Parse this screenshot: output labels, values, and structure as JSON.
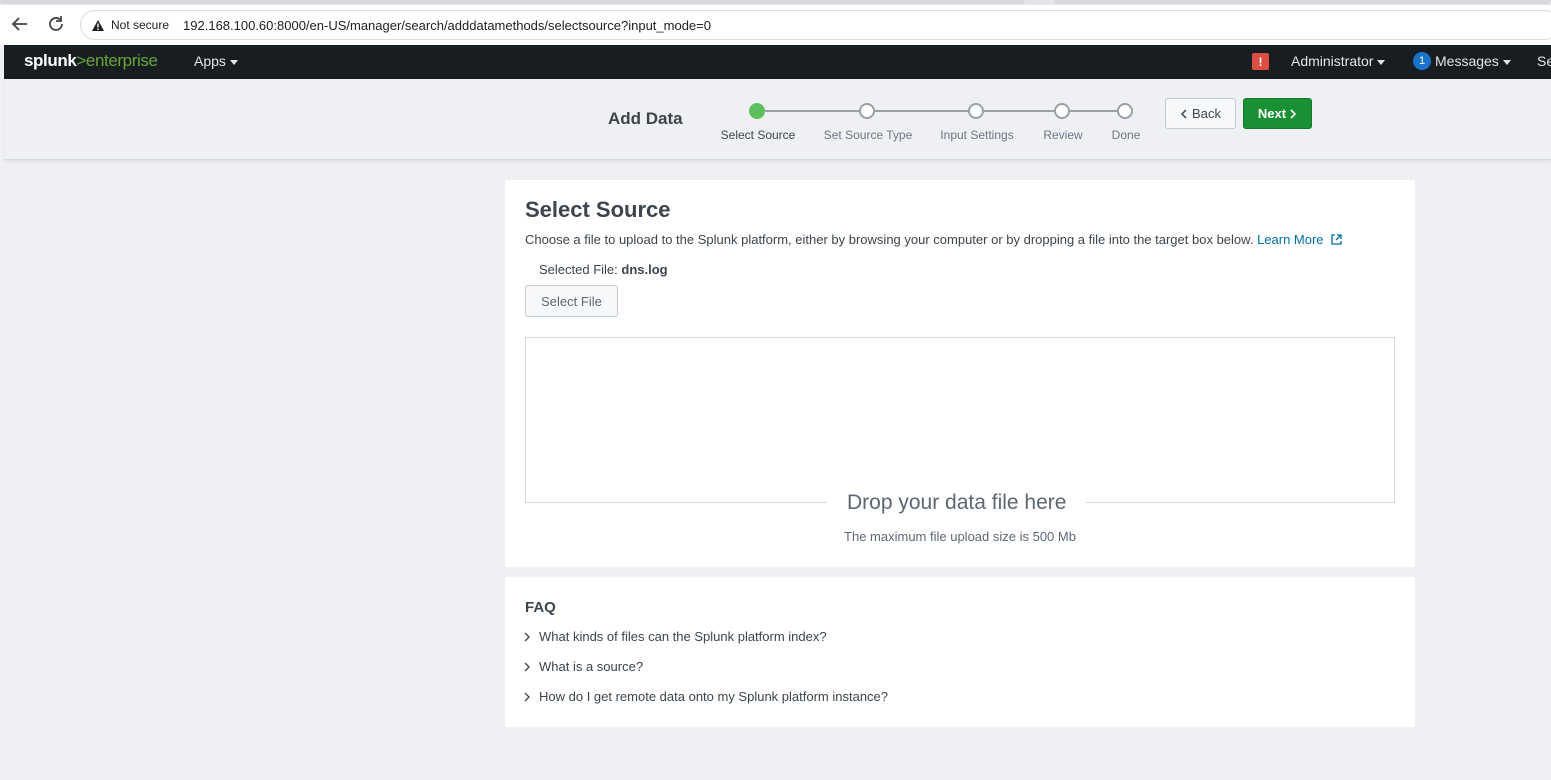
{
  "browser": {
    "security_label": "Not secure",
    "url": "192.168.100.60:8000/en-US/manager/search/adddatamethods/selectsource?input_mode=0"
  },
  "header": {
    "logo_brand": "splunk",
    "logo_gt": ">",
    "logo_product": "enterprise",
    "apps_label": "Apps",
    "alert_icon_text": "!",
    "admin_label": "Administrator",
    "messages_count": "1",
    "messages_label": "Messages",
    "settings_label": "Se"
  },
  "wizard": {
    "title": "Add Data",
    "steps": [
      {
        "label": "Select Source",
        "active": true
      },
      {
        "label": "Set Source Type",
        "active": false
      },
      {
        "label": "Input Settings",
        "active": false
      },
      {
        "label": "Review",
        "active": false
      },
      {
        "label": "Done",
        "active": false
      }
    ],
    "back_label": "Back",
    "next_label": "Next"
  },
  "select_source": {
    "heading": "Select Source",
    "description": "Choose a file to upload to the Splunk platform, either by browsing your computer or by dropping a file into the target box below.",
    "learn_more": "Learn More",
    "selected_file_label": "Selected File:",
    "selected_file_name": "dns.log",
    "select_file_button": "Select File",
    "drop_text": "Drop your data file here",
    "max_size_text": "The maximum file upload size is 500 Mb"
  },
  "faq": {
    "title": "FAQ",
    "items": [
      "What kinds of files can the Splunk platform index?",
      "What is a source?",
      "How do I get remote data onto my Splunk platform instance?"
    ]
  },
  "colors": {
    "active_step": "#5cc05c",
    "next_button": "#1a9035",
    "link": "#006eaa",
    "header_bg": "#171d21",
    "alert": "#dc4e41"
  }
}
